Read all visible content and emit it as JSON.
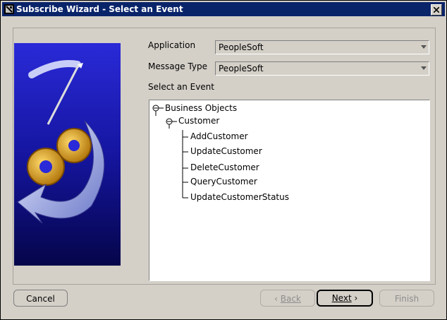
{
  "window": {
    "title": "Subscribe Wizard  - Select an Event",
    "icon": "wizard-app-icon",
    "close_icon": "close-x-icon"
  },
  "form": {
    "application_label": "Application",
    "application_value": "PeopleSoft",
    "message_type_label": "Message Type",
    "message_type_value": "PeopleSoft",
    "event_label": "Select an Event"
  },
  "tree": {
    "root": "Business Objects",
    "child": "Customer",
    "events": [
      "AddCustomer",
      "UpdateCustomer",
      "DeleteCustomer",
      "QueryCustomer",
      "UpdateCustomerStatus"
    ]
  },
  "buttons": {
    "cancel": "Cancel",
    "back": "Back",
    "next": "Next",
    "finish": "Finish"
  },
  "colors": {
    "titlebar": "#0a246a",
    "dialog_bg": "#d4d0c8",
    "graphic_bg": "#1a1aa8"
  }
}
